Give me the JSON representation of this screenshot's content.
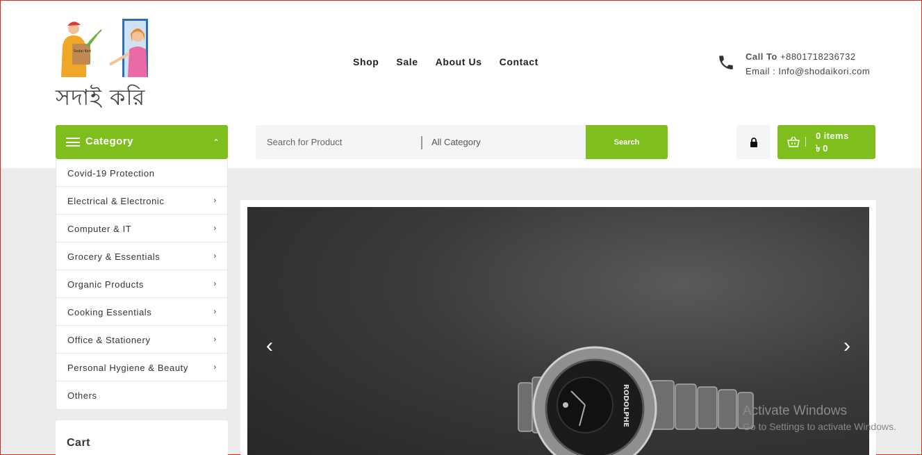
{
  "brand": {
    "logo_text": "সদাই করি",
    "logo_bag_text": "Sodai Kori"
  },
  "nav": {
    "items": [
      "Shop",
      "Sale",
      "About Us",
      "Contact"
    ]
  },
  "contact": {
    "call_label": "Call To",
    "phone": "+8801718236732",
    "email_line": "Email : Info@shodaikori.com"
  },
  "category_button": {
    "label": "Category"
  },
  "search": {
    "placeholder": "Search for Product",
    "category_select": "All Category",
    "button_label": "Search"
  },
  "cart_button": {
    "items": "0 items",
    "amount": "৳ 0"
  },
  "categories": [
    {
      "name": "Covid-19 Protection",
      "has_children": false
    },
    {
      "name": "Electrical & Electronic",
      "has_children": true
    },
    {
      "name": "Computer & IT",
      "has_children": true
    },
    {
      "name": "Grocery & Essentials",
      "has_children": true
    },
    {
      "name": "Organic Products",
      "has_children": true
    },
    {
      "name": "Cooking Essentials",
      "has_children": true
    },
    {
      "name": "Office & Stationery",
      "has_children": true
    },
    {
      "name": "Personal Hygiene & Beauty",
      "has_children": true
    },
    {
      "name": "Others",
      "has_children": false
    }
  ],
  "cart_panel": {
    "title": "Cart"
  },
  "slider": {
    "watch_brand": "RODOLPHE"
  },
  "os_overlay": {
    "title": "Activate Windows",
    "subtitle": "Go to Settings to activate Windows."
  },
  "colors": {
    "accent": "#7fbf1d",
    "page_bg": "#ececec"
  },
  "icons": {
    "phone": "phone-icon",
    "lock": "lock-icon",
    "basket": "basket-icon",
    "menu": "hamburger-icon",
    "chevron_up": "chevron-up-icon",
    "chevron_right": "chevron-right-icon"
  }
}
